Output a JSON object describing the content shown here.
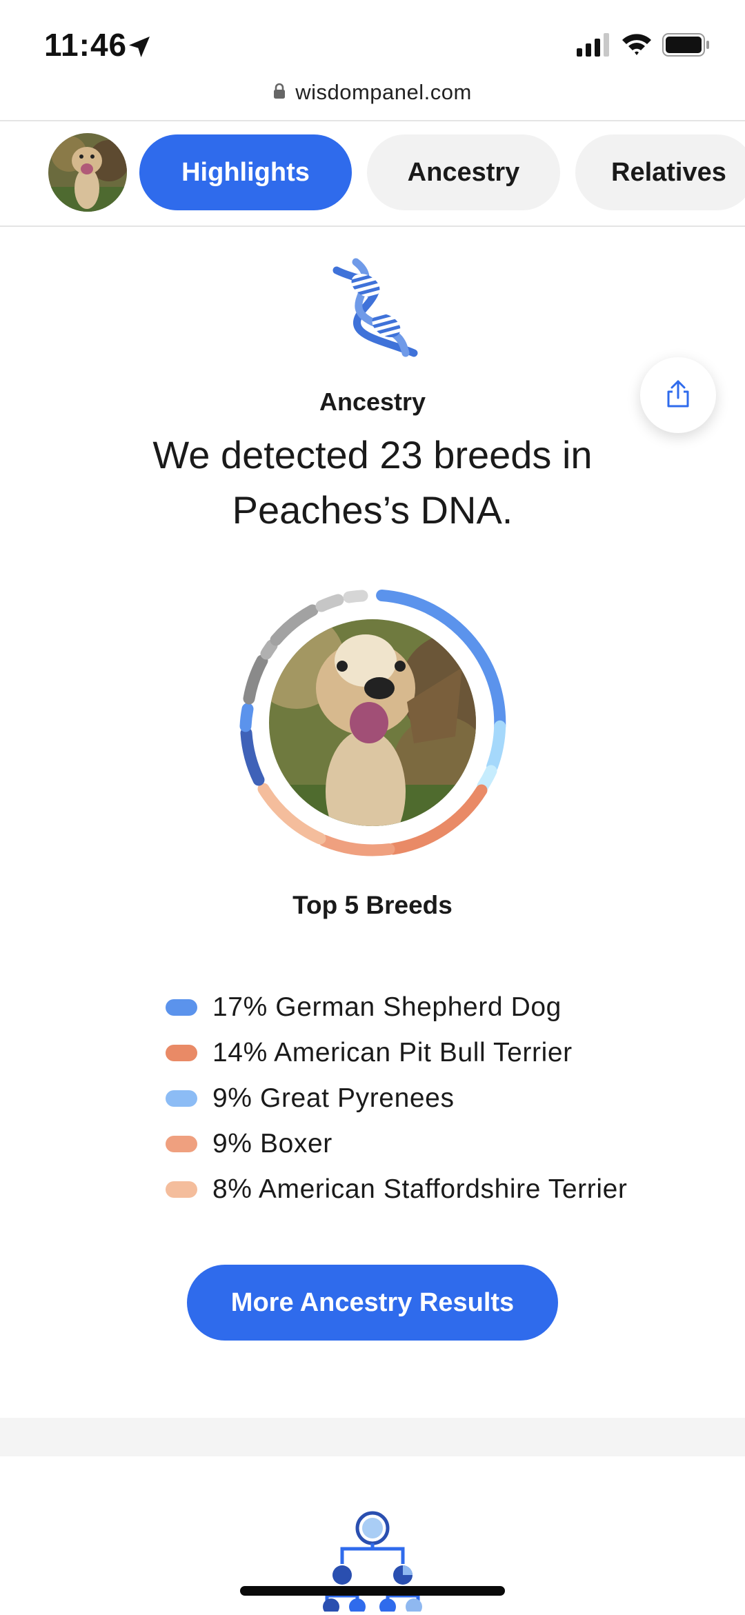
{
  "status_bar": {
    "time": "11:46",
    "location_icon": "location-arrow-icon",
    "signal_icon": "cellular-signal-icon",
    "wifi_icon": "wifi-icon",
    "battery_icon": "battery-icon"
  },
  "browser": {
    "lock_icon": "lock-icon",
    "url": "wisdompanel.com"
  },
  "tabs": [
    {
      "label": "Highlights",
      "active": true
    },
    {
      "label": "Ancestry",
      "active": false
    },
    {
      "label": "Relatives",
      "active": false
    }
  ],
  "ancestry": {
    "icon": "dna-icon",
    "label": "Ancestry",
    "headline": "We detected 23 breeds in Peaches’s DNA.",
    "top_breeds_label": "Top 5 Breeds",
    "breeds": [
      {
        "percent": "17%",
        "name": "German Shepherd Dog",
        "color": "#5b93ec"
      },
      {
        "percent": "14%",
        "name": "American Pit Bull Terrier",
        "color": "#e98a66"
      },
      {
        "percent": "9%",
        "name": "Great Pyrenees",
        "color": "#8cbcf5"
      },
      {
        "percent": "9%",
        "name": "Boxer",
        "color": "#efa07f"
      },
      {
        "percent": "8%",
        "name": "American Staffordshire Terrier",
        "color": "#f4bd9c"
      }
    ],
    "cta_label": "More Ancestry Results"
  },
  "share_icon": "share-icon",
  "next_section_icon": "family-tree-icon",
  "colors": {
    "accent": "#2f6bec",
    "tab_inactive_bg": "#f2f2f2"
  }
}
